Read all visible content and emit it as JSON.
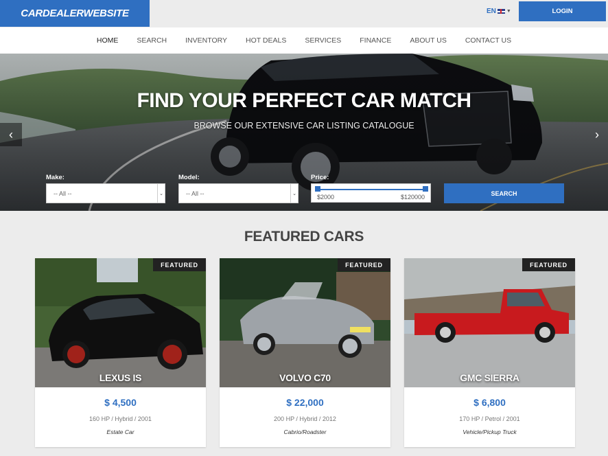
{
  "header": {
    "logo": "CARDEALERWEBSITE",
    "language": "EN",
    "login_label": "LOGIN"
  },
  "nav": {
    "items": [
      {
        "label": "HOME",
        "active": true
      },
      {
        "label": "SEARCH"
      },
      {
        "label": "INVENTORY"
      },
      {
        "label": "HOT DEALS"
      },
      {
        "label": "SERVICES"
      },
      {
        "label": "FINANCE"
      },
      {
        "label": "ABOUT US"
      },
      {
        "label": "CONTACT US"
      }
    ]
  },
  "hero": {
    "title": "FIND YOUR PERFECT CAR MATCH",
    "subtitle": "BROWSE OUR EXTENSIVE CAR LISTING CATALOGUE",
    "prev_icon": "chevron-left-icon",
    "next_icon": "chevron-right-icon"
  },
  "search": {
    "make_label": "Make:",
    "make_value": "-- All --",
    "model_label": "Model:",
    "model_value": "-- All --",
    "price_label": "Price:",
    "price_min": "$2000",
    "price_max": "$120000",
    "button_label": "SEARCH"
  },
  "featured": {
    "title": "FEATURED CARS",
    "cars": [
      {
        "badge": "FEATURED",
        "name": "LEXUS IS",
        "price": "$ 4,500",
        "specs": "160 HP / Hybrid / 2001",
        "type": "Estate Car",
        "color": "#111111"
      },
      {
        "badge": "FEATURED",
        "name": "VOLVO C70",
        "price": "$ 22,000",
        "specs": "200 HP / Hybrid / 2012",
        "type": "Cabrio/Roadster",
        "color": "#9ea3a8"
      },
      {
        "badge": "FEATURED",
        "name": "GMC SIERRA",
        "price": "$ 6,800",
        "specs": "170 HP / Petrol / 2001",
        "type": "Vehicle/Pickup Truck",
        "color": "#c81a1e"
      }
    ]
  },
  "colors": {
    "accent": "#2f6fc1",
    "badge": "#222222"
  }
}
